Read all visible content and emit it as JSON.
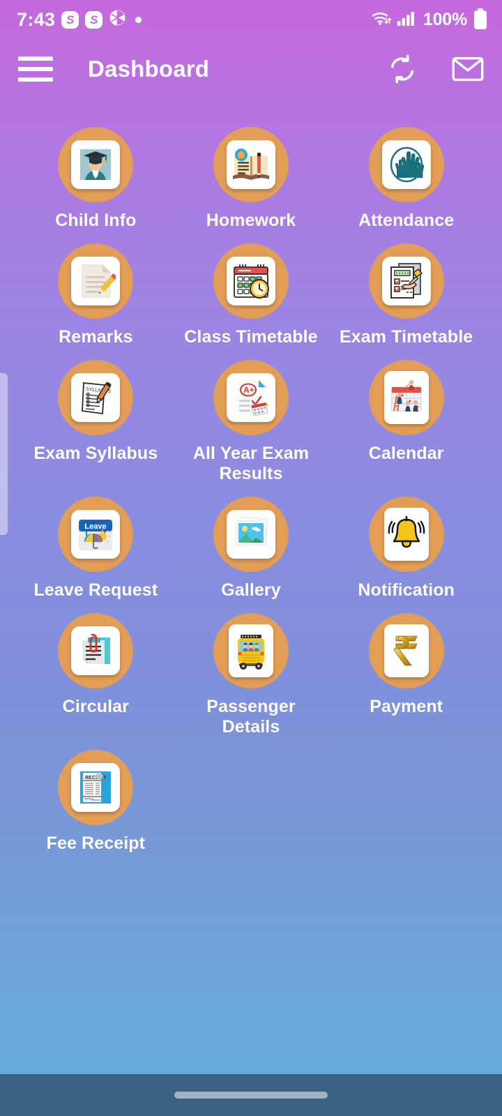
{
  "status_bar": {
    "time": "7:43",
    "icons": [
      "skype-icon",
      "skype-icon",
      "camera-aperture-icon",
      "dot-indicator"
    ],
    "wifi_icon": "wifi-icon",
    "signal_icon": "cellular-signal-icon",
    "battery_percent": "100%",
    "battery_icon": "battery-full-icon"
  },
  "app_bar": {
    "menu_icon": "hamburger-menu-icon",
    "title": "Dashboard",
    "refresh_icon": "refresh-sync-icon",
    "mail_icon": "mail-envelope-icon"
  },
  "colors": {
    "accent_circle": "#e29d57",
    "header_top": "#c569dd",
    "background_bottom": "#63aee0",
    "nav_bar": "#3c6283",
    "label_text": "#ffffff"
  },
  "grid": {
    "tiles": [
      {
        "label": "Child Info",
        "icon": "student-graduate-photo-icon"
      },
      {
        "label": "Homework",
        "icon": "open-book-pencil-icon"
      },
      {
        "label": "Attendance",
        "icon": "raised-hands-icon"
      },
      {
        "label": "Remarks",
        "icon": "document-pencil-icon"
      },
      {
        "label": "Class Timetable",
        "icon": "calendar-clock-icon"
      },
      {
        "label": "Exam Timetable",
        "icon": "checklist-hand-pen-icon"
      },
      {
        "label": "Exam Syllabus",
        "icon": "syllabus-paper-pen-icon"
      },
      {
        "label": "All Year Exam Results",
        "icon": "a-plus-report-icon"
      },
      {
        "label": "Calendar",
        "icon": "calendar-people-icon"
      },
      {
        "label": "Leave Request",
        "icon": "leave-beach-calendar-icon"
      },
      {
        "label": "Gallery",
        "icon": "photo-stack-icon"
      },
      {
        "label": "Notification",
        "icon": "ringing-bell-icon"
      },
      {
        "label": "Circular",
        "icon": "paperclip-document-icon"
      },
      {
        "label": "Passenger Details",
        "icon": "school-bus-icon"
      },
      {
        "label": "Payment",
        "icon": "rupee-symbol-icon"
      },
      {
        "label": "Fee Receipt",
        "icon": "receipt-icon"
      }
    ]
  },
  "nav_bar": {
    "home_indicator": "home-indicator-pill"
  }
}
